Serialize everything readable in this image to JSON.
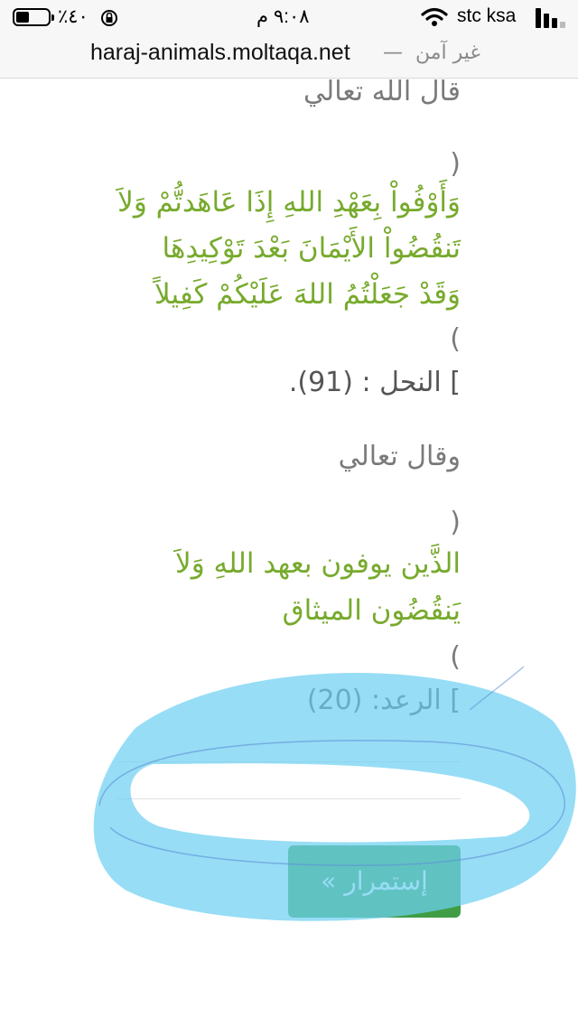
{
  "status_bar": {
    "battery": "٪٤٠",
    "time": "٩:٠٨ م",
    "carrier": "stc ksa"
  },
  "url_bar": {
    "url": "haraj-animals.moltaqa.net",
    "separator": "—",
    "security": "غير آمن"
  },
  "article": {
    "heading_1": "قال الله تعالي",
    "open_paren": "(",
    "verse_1_lines": [
      "وَأَوْفُواْ بِعَهْدِ اللهِ إِذَا عَاهَدتُّمْ وَلاَ",
      "تَنقُضُواْ الأَيْمَانَ بَعْدَ تَوْكِيدِهَا",
      "وَقَدْ جَعَلْتُمُ اللهَ عَلَيْكُمْ كَفِيلاً"
    ],
    "close_paren": ")",
    "ref_1": "] النحل : (91).",
    "heading_2": "وقال تعالي",
    "verse_2_lines": [
      "الذَّين يوفون بعهد اللهِ وَلاَ",
      "يَنقُضُون الميثاق"
    ],
    "ref_2": "] الرعد: (20)"
  },
  "continue_button": {
    "label": "إستمرار »"
  },
  "colors": {
    "verse": "#77aa2d",
    "button": "#3f9d45",
    "highlight": "#6fd0f2"
  }
}
